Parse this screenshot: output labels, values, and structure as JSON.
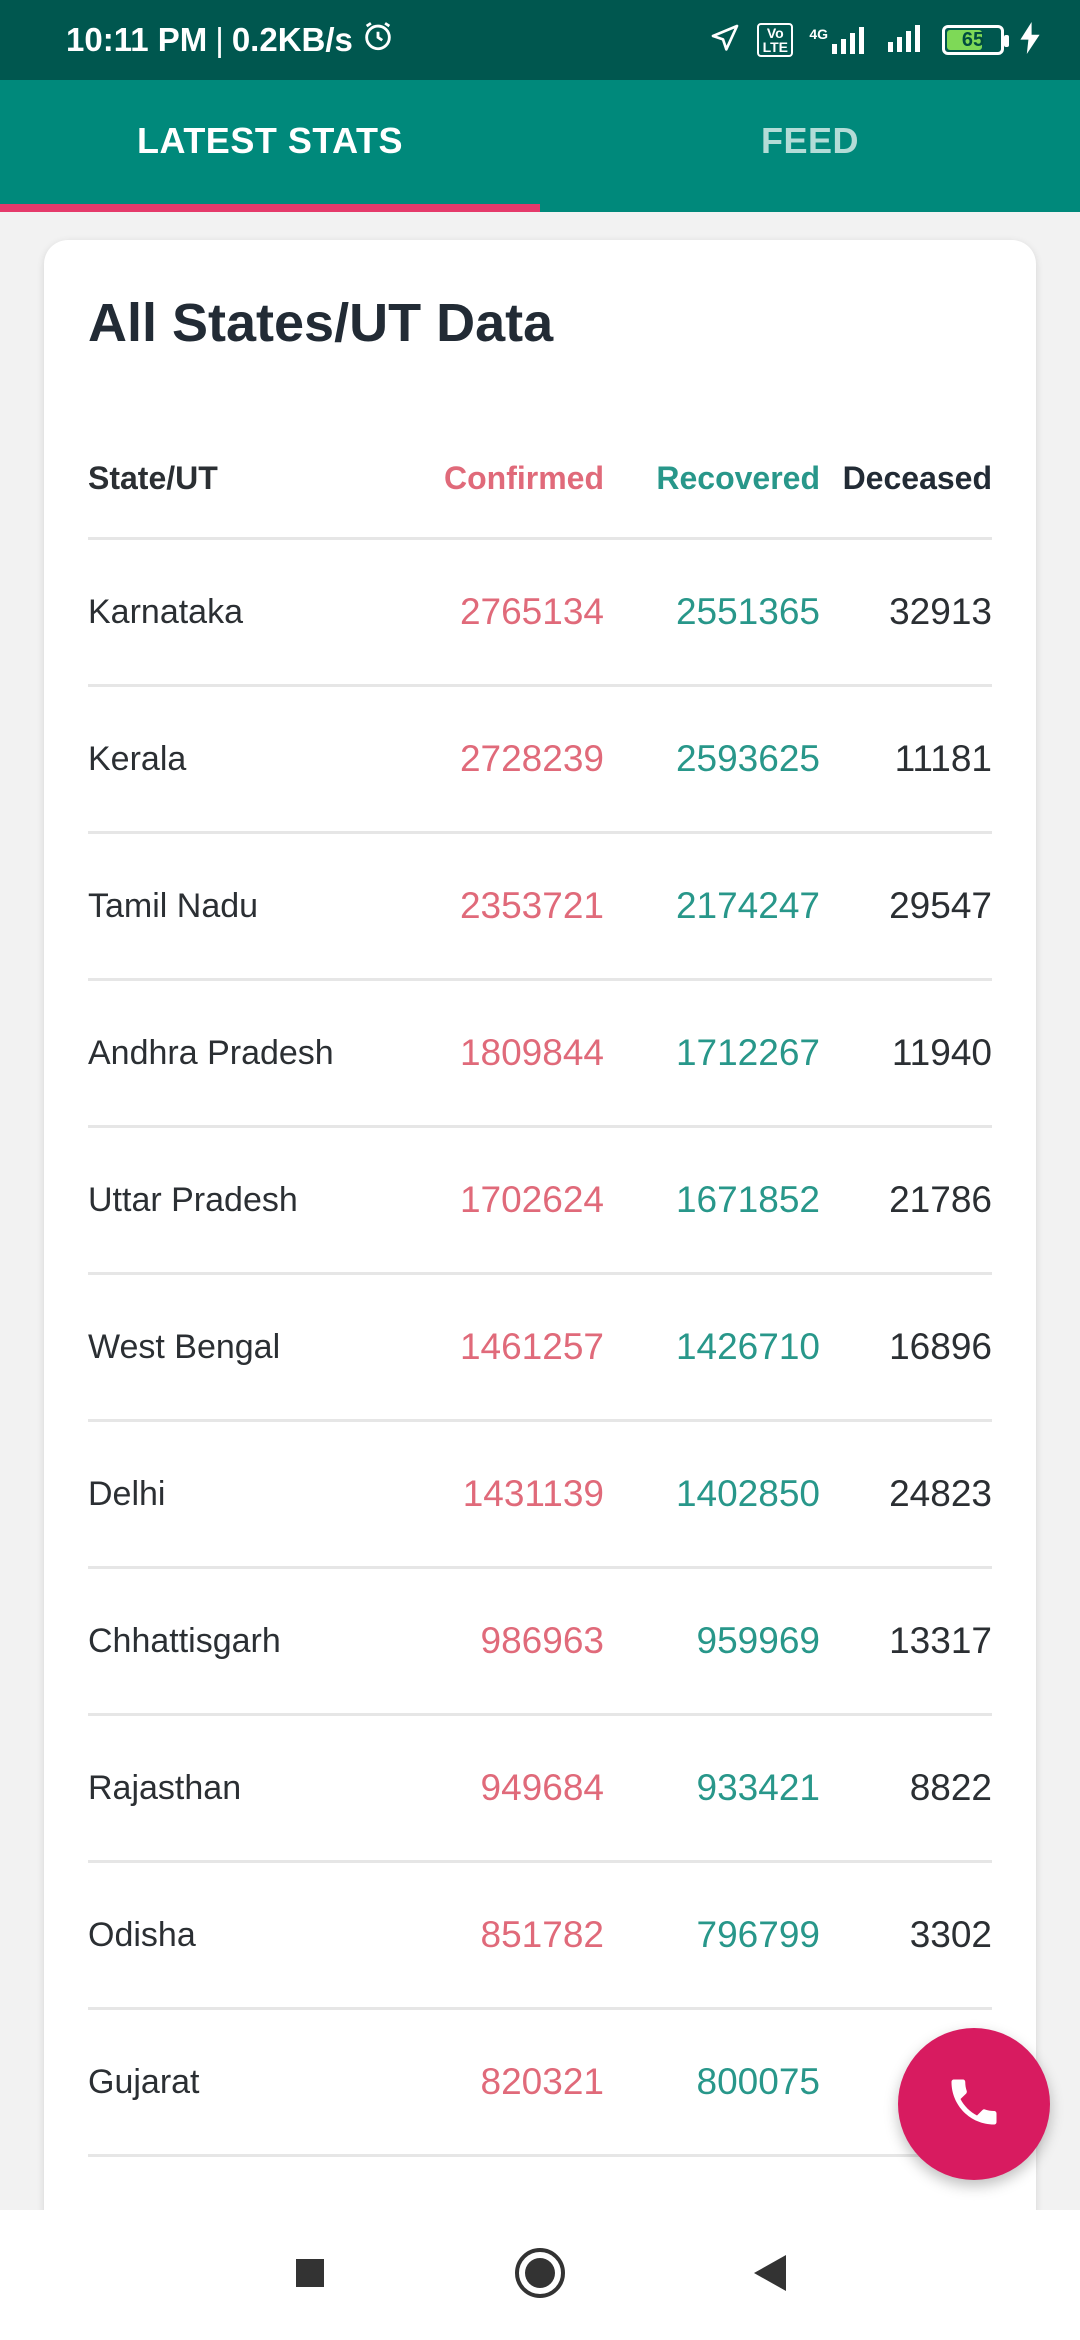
{
  "status_bar": {
    "time": "10:11 PM",
    "separator": "|",
    "net_speed": "0.2KB/s",
    "lte_label": "Vo LTE",
    "network": "4G",
    "battery": "65"
  },
  "tabs": [
    {
      "label": "LATEST STATS",
      "active": true
    },
    {
      "label": "FEED",
      "active": false
    }
  ],
  "card": {
    "title": "All States/UT Data",
    "columns": {
      "state": "State/UT",
      "confirmed": "Confirmed",
      "recovered": "Recovered",
      "deceased": "Deceased"
    },
    "rows": [
      {
        "state": "Karnataka",
        "confirmed": "2765134",
        "recovered": "2551365",
        "deceased": "32913"
      },
      {
        "state": "Kerala",
        "confirmed": "2728239",
        "recovered": "2593625",
        "deceased": "11181"
      },
      {
        "state": "Tamil Nadu",
        "confirmed": "2353721",
        "recovered": "2174247",
        "deceased": "29547"
      },
      {
        "state": "Andhra Pradesh",
        "confirmed": "1809844",
        "recovered": "1712267",
        "deceased": "11940"
      },
      {
        "state": "Uttar Pradesh",
        "confirmed": "1702624",
        "recovered": "1671852",
        "deceased": "21786"
      },
      {
        "state": "West Bengal",
        "confirmed": "1461257",
        "recovered": "1426710",
        "deceased": "16896"
      },
      {
        "state": "Delhi",
        "confirmed": "1431139",
        "recovered": "1402850",
        "deceased": "24823"
      },
      {
        "state": "Chhattisgarh",
        "confirmed": "986963",
        "recovered": "959969",
        "deceased": "13317"
      },
      {
        "state": "Rajasthan",
        "confirmed": "949684",
        "recovered": "933421",
        "deceased": "8822"
      },
      {
        "state": "Odisha",
        "confirmed": "851782",
        "recovered": "796799",
        "deceased": "3302"
      },
      {
        "state": "Gujarat",
        "confirmed": "820321",
        "recovered": "800075",
        "deceased": ""
      }
    ]
  },
  "fab": {
    "icon": "phone-icon"
  },
  "colors": {
    "status_bar": "#00574f",
    "tab_bar": "#00897b",
    "tab_indicator": "#e53a6b",
    "confirmed": "#e06a7a",
    "recovered": "#28978a",
    "fab": "#d81b60"
  }
}
